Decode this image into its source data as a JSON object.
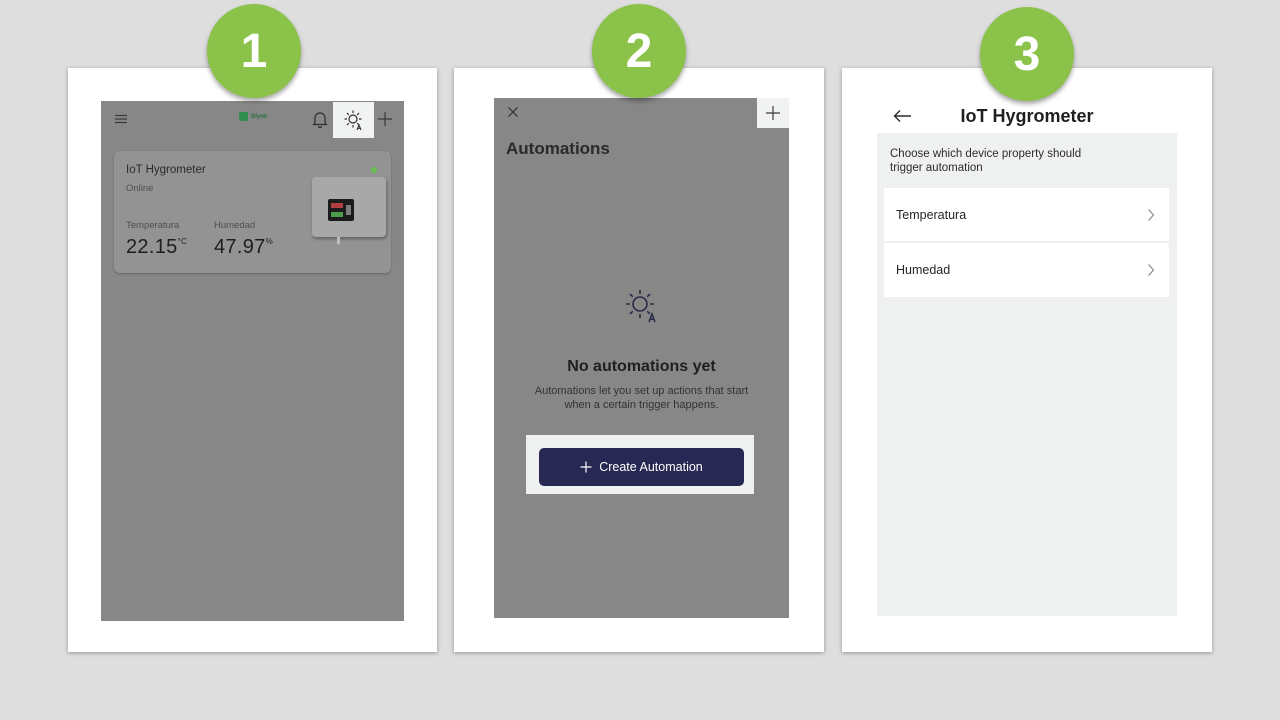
{
  "steps": [
    {
      "number": "1"
    },
    {
      "number": "2"
    },
    {
      "number": "3"
    }
  ],
  "colors": {
    "step_circle": "#8bc24a",
    "dimmed_overlay": "#878787",
    "highlight": "#eef1f0",
    "primary_button": "#272853",
    "online_dot": "#6bbf4f"
  },
  "screen1": {
    "header": {
      "menu_icon": "hamburger-menu-icon",
      "logo_text": "Blynk",
      "bell_icon": "bell-icon",
      "automation_icon": "sun-automation-icon",
      "add_icon": "plus-icon"
    },
    "device": {
      "name": "IoT Hygrometer",
      "status": "Online",
      "metrics": [
        {
          "label": "Temperatura",
          "value": "22.15",
          "unit": "°C"
        },
        {
          "label": "Humedad",
          "value": "47.97",
          "unit": "%"
        }
      ]
    }
  },
  "screen2": {
    "close_icon": "close-icon",
    "add_icon": "plus-icon",
    "title": "Automations",
    "empty_icon": "sun-automation-icon",
    "empty_title": "No automations yet",
    "empty_text_line1": "Automations let you set up actions that start",
    "empty_text_line2": "when a certain trigger happens.",
    "create_button": "Create Automation"
  },
  "screen3": {
    "back_icon": "arrow-left-icon",
    "title": "IoT Hygrometer",
    "description_line1": "Choose which device property should",
    "description_line2": "trigger automation",
    "properties": [
      {
        "label": "Temperatura"
      },
      {
        "label": "Humedad"
      }
    ]
  }
}
